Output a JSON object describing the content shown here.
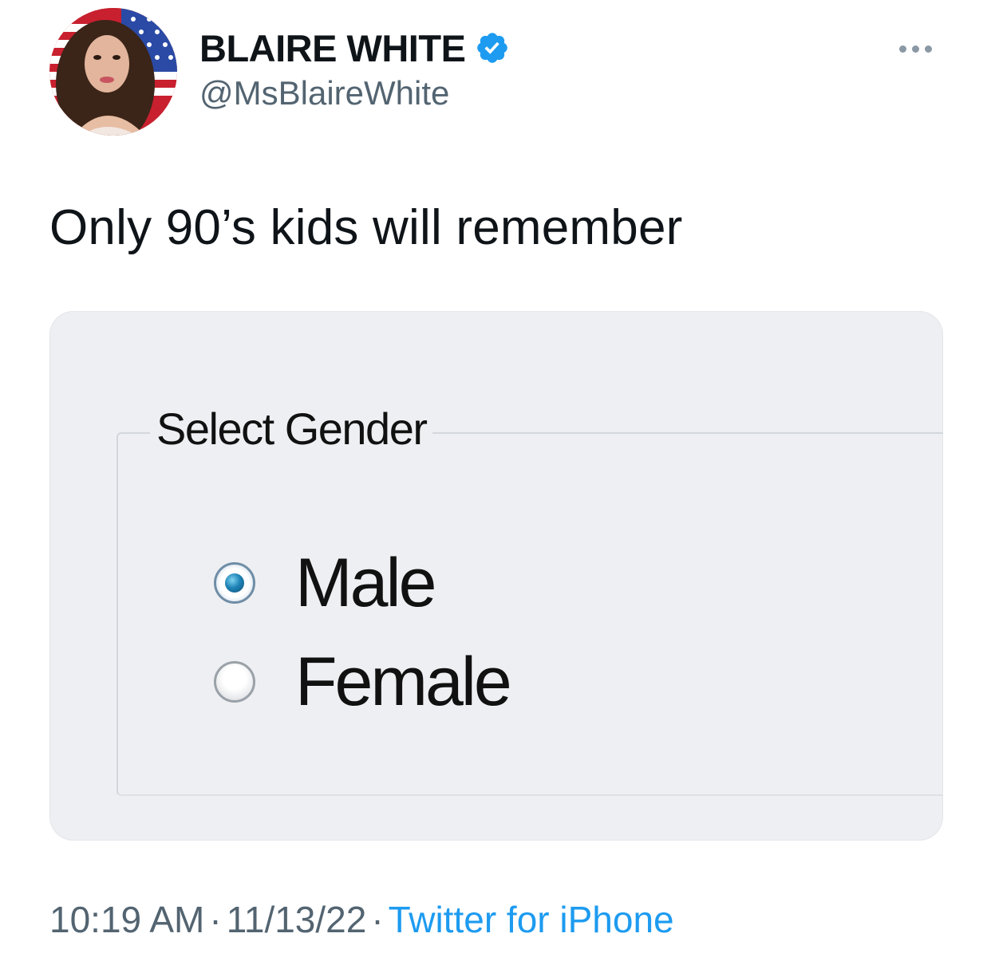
{
  "author": {
    "display_name": "BLAIRE WHITE",
    "handle": "@MsBlaireWhite",
    "verified": true,
    "verified_color": "#1d9bf0"
  },
  "tweet": {
    "text": "Only 90’s kids will remember"
  },
  "media": {
    "group_title": "Select Gender",
    "options": [
      {
        "label": "Male",
        "selected": true
      },
      {
        "label": "Female",
        "selected": false
      }
    ]
  },
  "meta": {
    "time": "10:19 AM",
    "separator": "·",
    "date": "11/13/22",
    "source": "Twitter for iPhone"
  },
  "icons": {
    "more": "more-horizontal-icon",
    "verified": "verified-badge-icon"
  },
  "colors": {
    "text_primary": "#0f1419",
    "text_secondary": "#536471",
    "link": "#1d9bf0"
  }
}
